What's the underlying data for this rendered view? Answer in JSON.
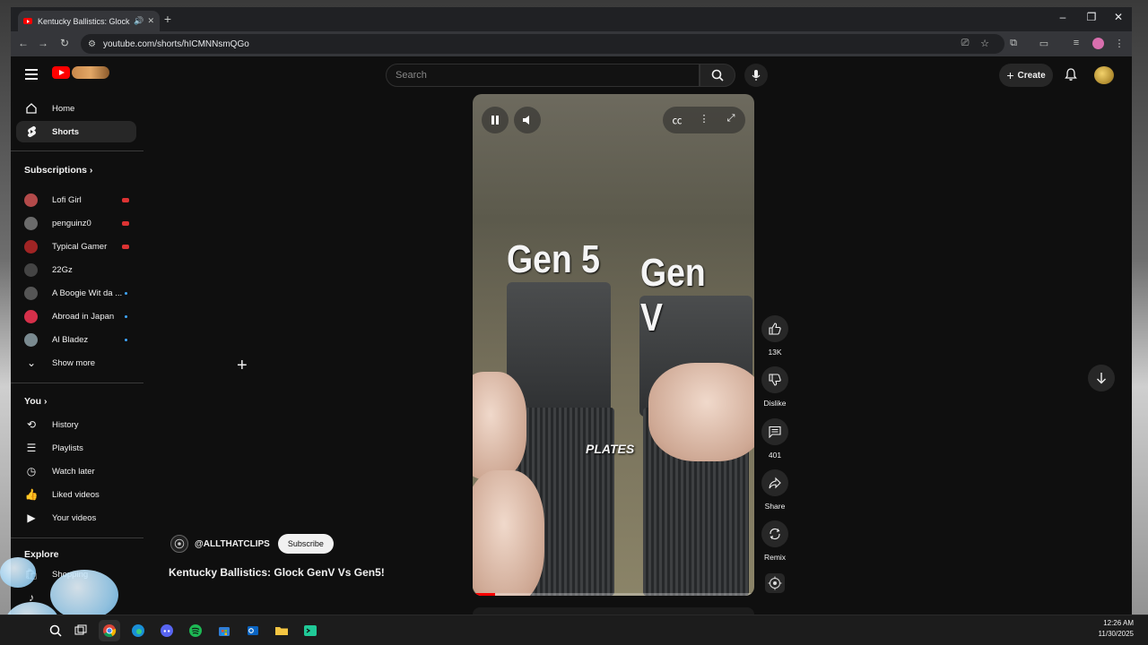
{
  "browser": {
    "tab_title": "Kentucky Ballistics: Glock G",
    "url": "youtube.com/shorts/hICMNNsmQGo"
  },
  "masthead": {
    "search_placeholder": "Search",
    "create_label": "Create"
  },
  "sidebar": {
    "main": [
      {
        "label": "Home",
        "icon": "home-icon"
      },
      {
        "label": "Shorts",
        "icon": "shorts-icon",
        "active": true
      }
    ],
    "subscriptions_heading": "Subscriptions",
    "subscriptions": [
      {
        "label": "Lofi Girl",
        "status": "live",
        "color": "#b34a4a"
      },
      {
        "label": "penguinz0",
        "status": "live",
        "color": "#6b6b6b"
      },
      {
        "label": "Typical Gamer",
        "status": "live",
        "color": "#a02424"
      },
      {
        "label": "22Gz",
        "status": "none",
        "color": "#444444"
      },
      {
        "label": "A Boogie Wit da ...",
        "status": "new",
        "color": "#555555"
      },
      {
        "label": "Abroad in Japan",
        "status": "new",
        "color": "#d6304a"
      },
      {
        "label": "Al Bladez",
        "status": "new",
        "color": "#7a8a90"
      }
    ],
    "show_more": "Show more",
    "you_heading": "You",
    "you_items": [
      {
        "label": "History",
        "icon": "history-icon"
      },
      {
        "label": "Playlists",
        "icon": "playlists-icon"
      },
      {
        "label": "Watch later",
        "icon": "watch-later-icon"
      },
      {
        "label": "Liked videos",
        "icon": "liked-videos-icon"
      },
      {
        "label": "Your videos",
        "icon": "your-videos-icon"
      }
    ],
    "explore_heading": "Explore",
    "explore_items": [
      {
        "label": "Shopping",
        "icon": "shopping-icon"
      }
    ]
  },
  "video": {
    "overlay_left": "Gen 5",
    "overlay_right": "Gen V",
    "caption": "PLATES",
    "progress": 0.08
  },
  "actions": {
    "likes": "13K",
    "dislike": "Dislike",
    "comments": "401",
    "share": "Share",
    "remix": "Remix"
  },
  "meta": {
    "channel": "@ALLTHATCLIPS",
    "subscribe": "Subscribe",
    "title": "Kentucky Ballistics: Glock GenV Vs Gen5!"
  },
  "taskbar": {
    "time": "12:26 AM",
    "date": "11/30/2025"
  },
  "colors": {
    "brand": "#ff0000",
    "background": "#0f0f0f",
    "chip": "#272727"
  }
}
